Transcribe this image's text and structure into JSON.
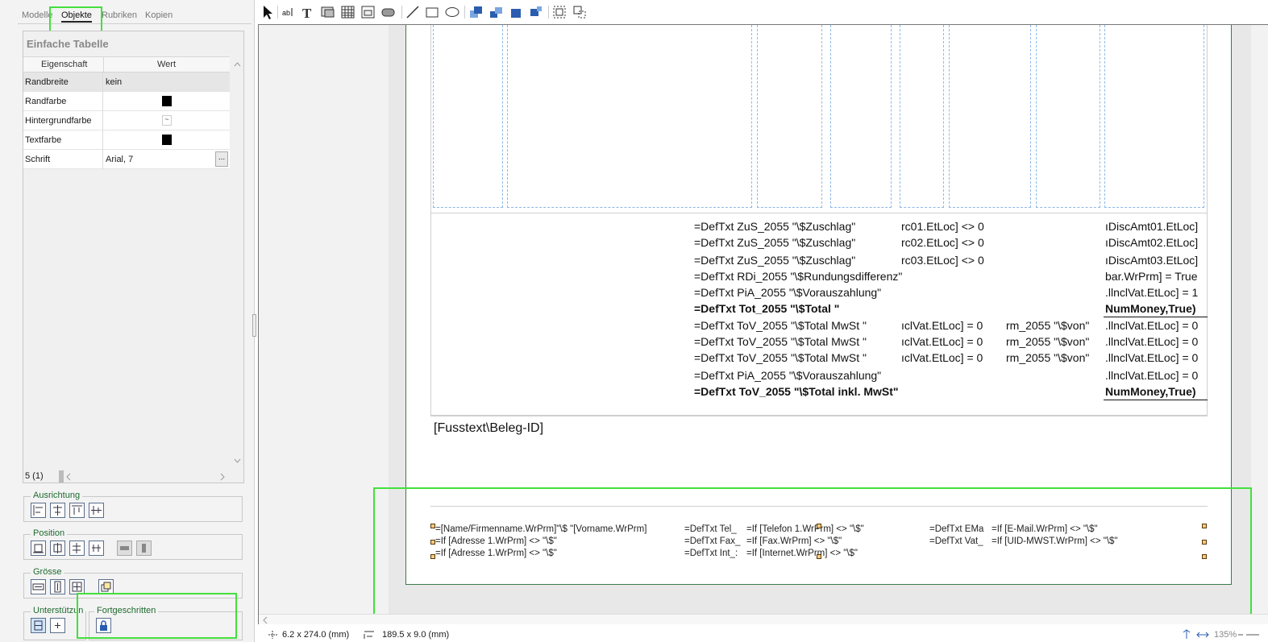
{
  "tabs": [
    "Modelle",
    "Objekte",
    "Rubriken",
    "Kopien"
  ],
  "props": {
    "title": "Einfache Tabelle",
    "col_property": "Eigenschaft",
    "col_value": "Wert",
    "rows": [
      {
        "name": "Randbreite",
        "value": "kein"
      },
      {
        "name": "Randfarbe",
        "value": ""
      },
      {
        "name": "Hintergrundfarbe",
        "value": "~"
      },
      {
        "name": "Textfarbe",
        "value": ""
      },
      {
        "name": "Schrift",
        "value": "Arial, 7"
      }
    ],
    "ellipsis": "...",
    "count": "5 (1)"
  },
  "groups": {
    "alignment": "Ausrichtung",
    "position": "Position",
    "size": "Grösse",
    "support": "Unterstützun",
    "advanced": "Fortgeschritten"
  },
  "totals": {
    "col1": [
      "=DefTxt ZuS_2055 \"\\$Zuschlag\"",
      "=DefTxt ZuS_2055 \"\\$Zuschlag\"",
      "=DefTxt ZuS_2055 \"\\$Zuschlag\"",
      "=DefTxt RDi_2055 \"\\$Rundungsdifferenz\"",
      "=DefTxt PiA_2055 \"\\$Vorauszahlung\"",
      "=DefTxt Tot_2055 \"\\$Total \"",
      "=DefTxt ToV_2055 \"\\$Total MwSt \"",
      "=DefTxt ToV_2055 \"\\$Total MwSt \"",
      "=DefTxt ToV_2055 \"\\$Total MwSt \"",
      "=DefTxt PiA_2055 \"\\$Vorauszahlung\"",
      "=DefTxt ToV_2055 \"\\$Total inkl. MwSt\""
    ],
    "col2": [
      "rc01.EtLoc] <> 0",
      "rc02.EtLoc] <> 0",
      "rc03.EtLoc] <> 0",
      "ıclVat.EtLoc] = 0",
      "ıclVat.EtLoc] = 0",
      "ıclVat.EtLoc] = 0"
    ],
    "col3": [
      "rm_2055 \"\\$von\"",
      "rm_2055 \"\\$von\"",
      "rm_2055 \"\\$von\""
    ],
    "col4": [
      "ıDiscAmt01.EtLoc]",
      "ıDiscAmt02.EtLoc]",
      "ıDiscAmt03.EtLoc]",
      "bar.WrPrm] = True",
      ".llnclVat.EtLoc] = 1",
      "NumMoney,True)",
      ".llnclVat.EtLoc] = 0",
      ".llnclVat.EtLoc] = 0",
      ".llnclVat.EtLoc] = 0",
      ".llnclVat.EtLoc] = 0",
      "NumMoney,True)"
    ]
  },
  "footer_text": "[Fusstext\\Beleg-ID]",
  "footer": {
    "a": [
      "=[Name/Firmenname.WrPrm]\"\\$ \"[Vorname.WrPrm]",
      "=If [Adresse 1.WrPrm] <> \"\\$\"",
      "=If [Adresse 1.WrPrm] <> \"\\$\""
    ],
    "b": [
      "=DefTxt Tel_",
      "=DefTxt Fax_",
      "=DefTxt Int_:"
    ],
    "c": [
      "=If [Telefon 1.WrPrm] <> \"\\$\"",
      "=If [Fax.WrPrm] <> \"\\$\"",
      "=If [Internet.WrPrm] <> \"\\$\""
    ],
    "d": [
      "=DefTxt EMa",
      "=DefTxt Vat_"
    ],
    "e": [
      "=If [E-Mail.WrPrm] <> \"\\$\"",
      "=If [UID-MWST.WrPrm] <> \"\\$\""
    ]
  },
  "status": {
    "pos": "6.2 x 274.0 (mm)",
    "size": "189.5 x 9.0 (mm)",
    "zoom": "135%"
  },
  "colors": {
    "highlight": "#43e03c",
    "page_border": "#3a7a4b",
    "guide": "#8cb8e8"
  }
}
